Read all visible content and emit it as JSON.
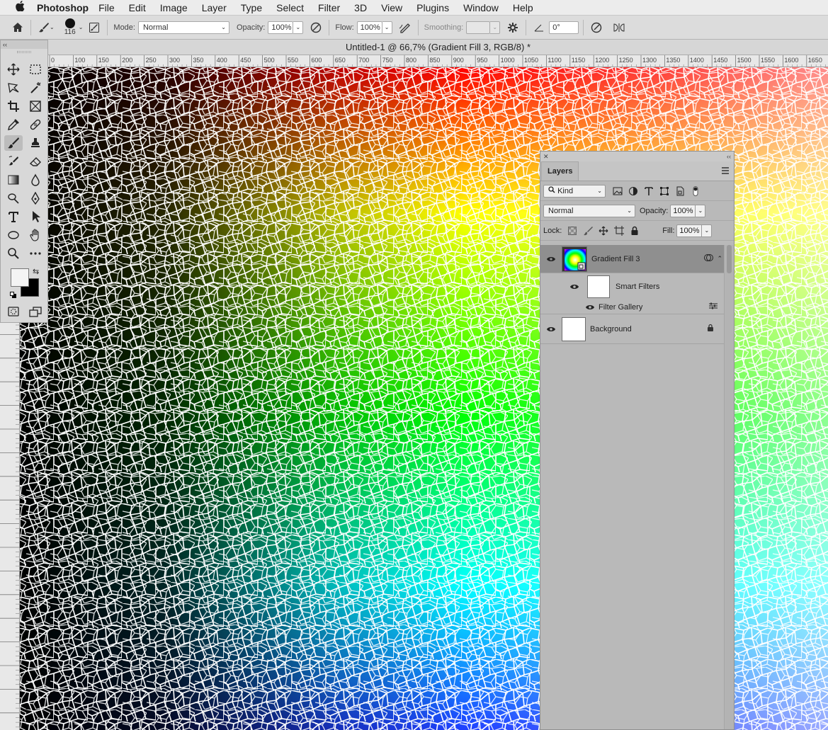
{
  "menubar": {
    "app_name": "Photoshop",
    "items": [
      "File",
      "Edit",
      "Image",
      "Layer",
      "Type",
      "Select",
      "Filter",
      "3D",
      "View",
      "Plugins",
      "Window",
      "Help"
    ]
  },
  "options_bar": {
    "brush_size": "116",
    "mode_label": "Mode:",
    "mode_value": "Normal",
    "opacity_label": "Opacity:",
    "opacity_value": "100%",
    "flow_label": "Flow:",
    "flow_value": "100%",
    "smoothing_label": "Smoothing:",
    "smoothing_value": "",
    "angle_value": "0°"
  },
  "document": {
    "title": "Untitled-1 @ 66,7% (Gradient Fill 3, RGB/8) *"
  },
  "ruler": {
    "horizontal_ticks": [
      "0",
      "100",
      "150",
      "200",
      "250",
      "300",
      "350",
      "400",
      "450",
      "500",
      "550",
      "600",
      "650",
      "700",
      "750",
      "800",
      "850",
      "900",
      "950",
      "1000",
      "1050",
      "1100",
      "1150",
      "1200",
      "1250",
      "1300",
      "1350",
      "1400",
      "1450",
      "1500",
      "1550",
      "1600",
      "1650"
    ]
  },
  "toolbox": {
    "tools": [
      "move-icon",
      "marquee-icon",
      "lasso-icon",
      "magic-wand-icon",
      "crop-icon",
      "frame-icon",
      "eyedropper-icon",
      "healing-icon",
      "brush-icon",
      "stamp-icon",
      "history-brush-icon",
      "eraser-icon",
      "gradient-icon",
      "blur-icon",
      "dodge-icon",
      "pen-icon",
      "type-icon",
      "path-select-icon",
      "ellipse-icon",
      "hand-icon",
      "zoom-icon",
      "more-icon"
    ],
    "foreground_color": "#f4f4f4",
    "background_color": "#000000"
  },
  "layers_panel": {
    "tab_label": "Layers",
    "filter_kind": "Kind",
    "blend_mode": "Normal",
    "opacity_label": "Opacity:",
    "opacity_value": "100%",
    "lock_label": "Lock:",
    "fill_label": "Fill:",
    "fill_value": "100%",
    "layers": [
      {
        "name": "Gradient Fill 3",
        "selected": true
      },
      {
        "name": "Smart Filters"
      },
      {
        "name": "Filter Gallery"
      },
      {
        "name": "Background",
        "locked": true
      }
    ]
  },
  "colors": {
    "panel_bg": "#b9b9b9",
    "selected_layer": "#8f8f8f",
    "mosaic_lines": "#ffffff"
  }
}
